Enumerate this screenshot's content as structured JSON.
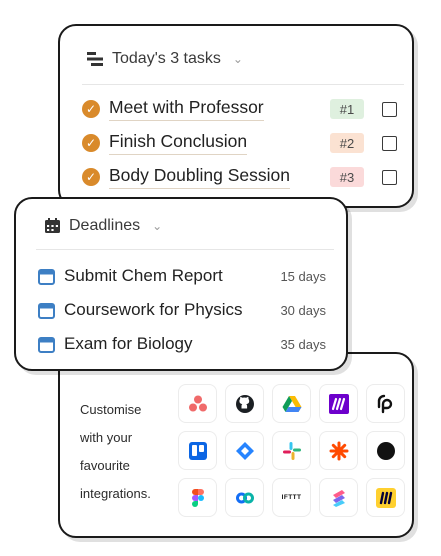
{
  "tasks_card": {
    "title": "Today's 3 tasks",
    "items": [
      {
        "title": "Meet with Professor",
        "tag": "#1",
        "tag_color": "#dff0df"
      },
      {
        "title": "Finish Conclusion",
        "tag": "#2",
        "tag_color": "#fbe2d2"
      },
      {
        "title": "Body Doubling Session",
        "tag": "#3",
        "tag_color": "#fbdada"
      }
    ]
  },
  "deadlines_card": {
    "title": "Deadlines",
    "items": [
      {
        "title": "Submit Chem Report",
        "days": "15 days"
      },
      {
        "title": "Coursework for Physics",
        "days": "30 days"
      },
      {
        "title": "Exam for Biology",
        "days": "35 days"
      }
    ]
  },
  "integrations_card": {
    "blurb_lines": [
      "Customise",
      "with your",
      "favourite",
      "integrations."
    ],
    "apps": [
      "asana-icon",
      "github-icon",
      "google-drive-icon",
      "make-icon",
      "pipedream-icon",
      "trello-icon",
      "jira-icon",
      "slack-icon",
      "zapier-icon",
      "black-circle-icon",
      "figma-icon",
      "webflow-icon",
      "ifttt-icon",
      "clickup-icon",
      "miro-icon"
    ],
    "ifttt_label": "IFTTT"
  },
  "colors": {
    "accent_check": "#d98a2b",
    "calendar_blue": "#3d7fc4"
  }
}
